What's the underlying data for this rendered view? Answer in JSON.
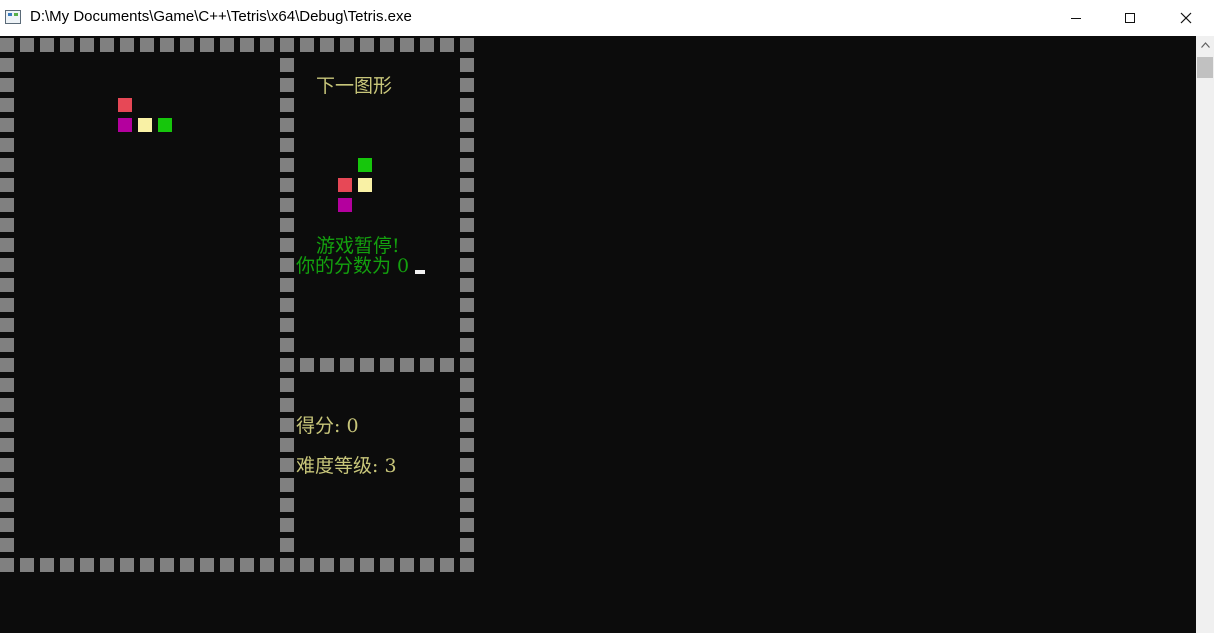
{
  "window": {
    "title": "D:\\My Documents\\Game\\C++\\Tetris\\x64\\Debug\\Tetris.exe",
    "icon": "console-app-icon",
    "controls": [
      "minimize",
      "maximize",
      "close"
    ]
  },
  "colors": {
    "background": "#0c0c0c",
    "wall": "#808080",
    "red": "#e74856",
    "purple": "#b4009e",
    "light_yellow": "#f9f1a5",
    "green": "#16c60c",
    "label_yellow": "#c8c67a",
    "label_green": "#13a10e"
  },
  "game": {
    "next_label": "下一图形",
    "pause_message": "游戏暂停!",
    "score_message": "你的分数为 0",
    "score_label": "得分: 0",
    "level_label": "难度等级: 3",
    "score": 0,
    "level": 3,
    "falling_piece": {
      "grid_cells": [
        [
          6,
          3,
          "red"
        ],
        [
          6,
          4,
          "purple"
        ],
        [
          7,
          4,
          "light_yellow"
        ],
        [
          8,
          4,
          "green"
        ]
      ]
    },
    "next_piece": {
      "grid_cells": [
        [
          18,
          6,
          "green"
        ],
        [
          17,
          7,
          "red"
        ],
        [
          18,
          7,
          "light_yellow"
        ],
        [
          17,
          8,
          "purple"
        ]
      ]
    }
  }
}
